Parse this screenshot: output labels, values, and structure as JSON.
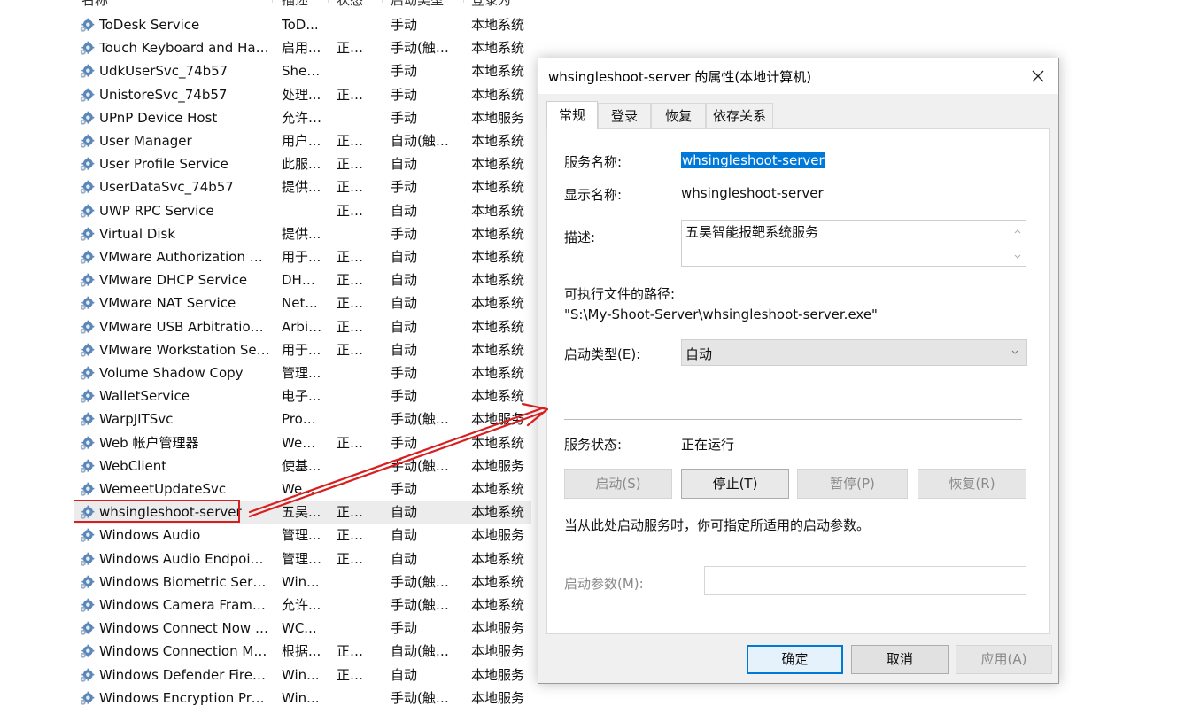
{
  "header": {
    "name": "名称",
    "description": "描述",
    "status": "状态",
    "startup_type": "启动类型",
    "logon_as": "登录为"
  },
  "services": [
    {
      "name": "ToDesk Service",
      "description": "ToD...",
      "status": "",
      "startup": "手动",
      "logon": "本地系统"
    },
    {
      "name": "Touch Keyboard and Hand...",
      "description": "启用...",
      "status": "正在...",
      "startup": "手动(触发...",
      "logon": "本地系统"
    },
    {
      "name": "UdkUserSvc_74b57",
      "description": "Shell...",
      "status": "",
      "startup": "手动",
      "logon": "本地系统"
    },
    {
      "name": "UnistoreSvc_74b57",
      "description": "处理...",
      "status": "正在...",
      "startup": "手动",
      "logon": "本地系统"
    },
    {
      "name": "UPnP Device Host",
      "description": "允许 ...",
      "status": "",
      "startup": "手动",
      "logon": "本地服务"
    },
    {
      "name": "User Manager",
      "description": "用户...",
      "status": "正在...",
      "startup": "自动(触发...",
      "logon": "本地系统"
    },
    {
      "name": "User Profile Service",
      "description": "此服...",
      "status": "正在...",
      "startup": "自动",
      "logon": "本地系统"
    },
    {
      "name": "UserDataSvc_74b57",
      "description": "提供...",
      "status": "正在...",
      "startup": "手动",
      "logon": "本地系统"
    },
    {
      "name": "UWP RPC Service",
      "description": "",
      "status": "正在...",
      "startup": "自动",
      "logon": "本地系统"
    },
    {
      "name": "Virtual Disk",
      "description": "提供...",
      "status": "",
      "startup": "手动",
      "logon": "本地系统"
    },
    {
      "name": "VMware Authorization Ser...",
      "description": "用于...",
      "status": "正在...",
      "startup": "自动",
      "logon": "本地系统"
    },
    {
      "name": "VMware DHCP Service",
      "description": "DHC...",
      "status": "正在...",
      "startup": "自动",
      "logon": "本地系统"
    },
    {
      "name": "VMware NAT Service",
      "description": "Net...",
      "status": "正在...",
      "startup": "自动",
      "logon": "本地系统"
    },
    {
      "name": "VMware USB Arbitration S...",
      "description": "Arbit...",
      "status": "正在...",
      "startup": "自动",
      "logon": "本地系统"
    },
    {
      "name": "VMware Workstation Server",
      "description": "用于...",
      "status": "正在...",
      "startup": "自动",
      "logon": "本地系统"
    },
    {
      "name": "Volume Shadow Copy",
      "description": "管理...",
      "status": "",
      "startup": "手动",
      "logon": "本地系统"
    },
    {
      "name": "WalletService",
      "description": "电子...",
      "status": "",
      "startup": "手动",
      "logon": "本地系统"
    },
    {
      "name": "WarpJITSvc",
      "description": "Provi...",
      "status": "",
      "startup": "手动(触发...",
      "logon": "本地服务"
    },
    {
      "name": "Web 帐户管理器",
      "description": "Web...",
      "status": "正在...",
      "startup": "手动",
      "logon": "本地系统"
    },
    {
      "name": "WebClient",
      "description": "使基...",
      "status": "",
      "startup": "手动(触发...",
      "logon": "本地服务"
    },
    {
      "name": "WemeetUpdateSvc",
      "description": "We...",
      "status": "",
      "startup": "手动",
      "logon": "本地系统"
    },
    {
      "name": "whsingleshoot-server",
      "description": "五昊...",
      "status": "正在...",
      "startup": "自动",
      "logon": "本地系统",
      "selected": true
    },
    {
      "name": "Windows Audio",
      "description": "管理...",
      "status": "正在...",
      "startup": "自动",
      "logon": "本地服务"
    },
    {
      "name": "Windows Audio Endpoint B...",
      "description": "管理 ...",
      "status": "正在...",
      "startup": "自动",
      "logon": "本地系统"
    },
    {
      "name": "Windows Biometric Service",
      "description": "Win...",
      "status": "",
      "startup": "手动(触发...",
      "logon": "本地系统"
    },
    {
      "name": "Windows Camera Frame S...",
      "description": "允许...",
      "status": "",
      "startup": "手动(触发...",
      "logon": "本地系统"
    },
    {
      "name": "Windows Connect Now - C...",
      "description": "WC...",
      "status": "",
      "startup": "手动",
      "logon": "本地服务"
    },
    {
      "name": "Windows Connection Man...",
      "description": "根据...",
      "status": "正在...",
      "startup": "自动(触发...",
      "logon": "本地服务"
    },
    {
      "name": "Windows Defender Firewall",
      "description": "Win...",
      "status": "正在...",
      "startup": "自动",
      "logon": "本地服务"
    },
    {
      "name": "Windows Encryption Provid...",
      "description": "Win...",
      "status": "",
      "startup": "手动(触发...",
      "logon": "本地服务"
    }
  ],
  "dialog": {
    "title": "whsingleshoot-server 的属性(本地计算机)",
    "tabs": [
      "常规",
      "登录",
      "恢复",
      "依存关系"
    ],
    "service_name_label": "服务名称:",
    "service_name_value": "whsingleshoot-server",
    "display_name_label": "显示名称:",
    "display_name_value": "whsingleshoot-server",
    "description_label": "描述:",
    "description_value": "五昊智能报靶系统服务",
    "exe_path_label": "可执行文件的路径:",
    "exe_path_value": "\"S:\\My-Shoot-Server\\whsingleshoot-server.exe\"",
    "startup_type_label": "启动类型(E):",
    "startup_type_value": "自动",
    "service_status_label": "服务状态:",
    "service_status_value": "正在运行",
    "start_button": "启动(S)",
    "stop_button": "停止(T)",
    "pause_button": "暂停(P)",
    "resume_button": "恢复(R)",
    "hint": "当从此处启动服务时，你可指定所适用的启动参数。",
    "param_label": "启动参数(M):",
    "ok_button": "确定",
    "cancel_button": "取消",
    "apply_button": "应用(A)"
  },
  "colors": {
    "highlight": "#0078d7",
    "annotation_red": "#d81e1e"
  }
}
